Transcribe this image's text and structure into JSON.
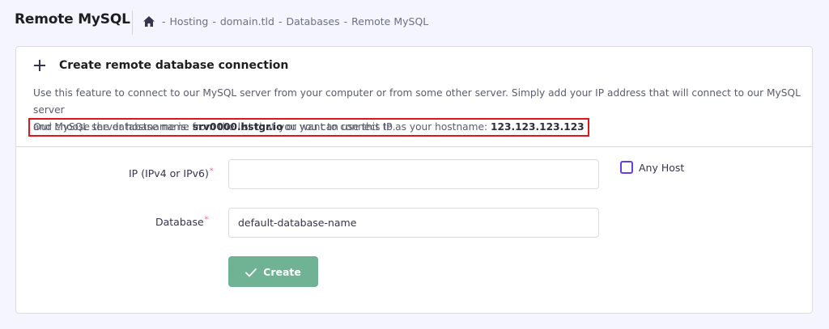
{
  "header": {
    "title": "Remote MySQL",
    "breadcrumb": {
      "home_icon": "home-icon",
      "separator": "-",
      "items": [
        "Hosting",
        "domain.tld",
        "Databases",
        "Remote MySQL"
      ]
    }
  },
  "card": {
    "title": "Create remote database connection",
    "title_icon": "plus-icon",
    "description_line1": "Use this feature to connect to our MySQL server from your computer or from some other server. Simply add your IP address that will connect to our MySQL server",
    "description_line2": "and choose the database name from the list that you want to connect to.",
    "hostname_notice": {
      "prefix": "Our MySQL server hostname is: ",
      "hostname": "srv0000.hstgr.io",
      "middle": " or you can use this IP as your hostname: ",
      "ip": "123.123.123.123"
    }
  },
  "form": {
    "ip_label": "IP (IPv4 or IPv6)",
    "ip_required_mark": "*",
    "ip_value": "",
    "any_host_label": "Any Host",
    "any_host_checked": false,
    "database_label": "Database",
    "database_required_mark": "*",
    "database_value": "default-database-name",
    "create_label": "Create",
    "create_icon": "check-icon"
  },
  "colors": {
    "accent": "#673de6",
    "button": "#6fb394",
    "highlight_border": "#e0161c",
    "required": "#fc5185"
  }
}
